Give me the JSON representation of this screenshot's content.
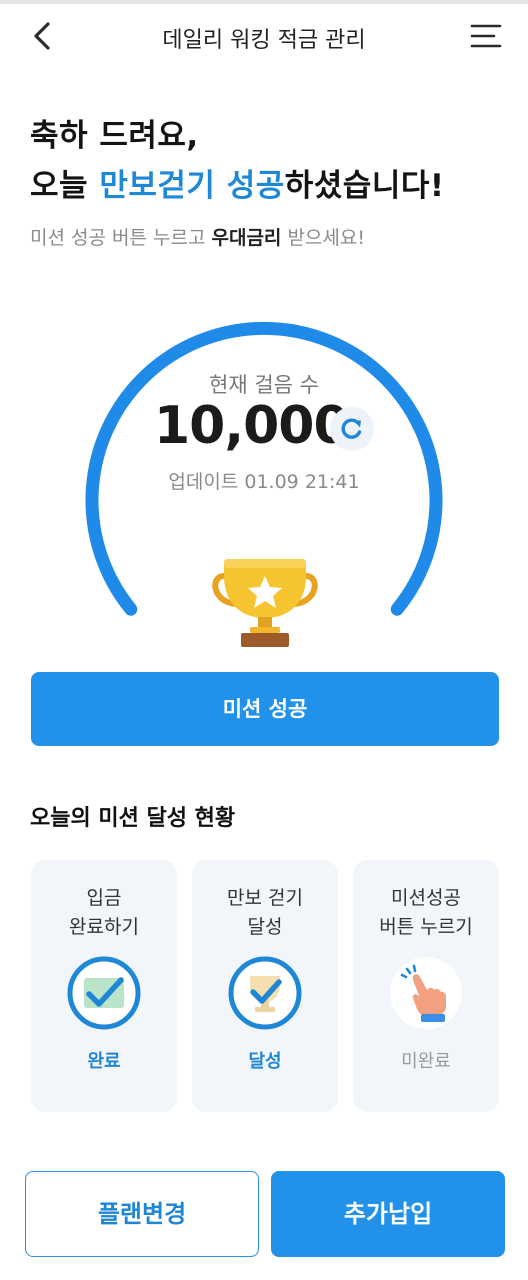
{
  "header": {
    "title": "데일리 워킹 적금 관리",
    "back_icon": "chevron-left-icon",
    "menu_icon": "hamburger-menu-icon"
  },
  "headline": {
    "line1": "축하 드려요,",
    "line2_prefix": "오늘 ",
    "line2_accent": "만보걷기 성공",
    "line2_suffix": "하셨습니다!",
    "sub_prefix": "미션 성공 버튼 누르고 ",
    "sub_bold": "우대금리",
    "sub_suffix": " 받으세요!"
  },
  "steps": {
    "label": "현재 걸음 수",
    "value": "10,000",
    "progress": 1.0,
    "updated": "업데이트 01.09 21:41",
    "refresh_icon": "refresh-icon",
    "trophy_icon": "trophy-icon"
  },
  "mission_button": "미션 성공",
  "status_section": {
    "title": "오늘의 미션 달성 현황",
    "cards": [
      {
        "title1": "입금",
        "title2": "완료하기",
        "status": "완료",
        "icon": "deposit-check-icon"
      },
      {
        "title1": "만보 걷기",
        "title2": "달성",
        "status": "달성",
        "icon": "trophy-check-icon"
      },
      {
        "title1": "미션성공",
        "title2": "버튼 누르기",
        "status": "미완료",
        "icon": "hand-tap-icon"
      }
    ]
  },
  "bottom": {
    "plan_change": "플랜변경",
    "extra_deposit": "추가납입"
  },
  "colors": {
    "accent": "#1f88d6",
    "button": "#2191ea",
    "card_bg": "#f2f6fb",
    "trophy": "#f7c431"
  }
}
